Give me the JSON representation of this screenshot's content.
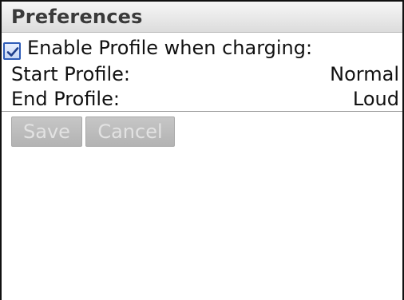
{
  "window": {
    "title": "Preferences"
  },
  "preferences": {
    "enable_profile_label": "Enable Profile when charging:",
    "enable_profile_checked": true,
    "start_profile_label": "Start Profile:",
    "start_profile_value": "Normal",
    "end_profile_label": "End Profile:",
    "end_profile_value": "Loud"
  },
  "buttons": {
    "save_label": "Save",
    "cancel_label": "Cancel",
    "enabled": false
  },
  "colors": {
    "checkbox_accent": "#2f5db8",
    "disabled_button_bg": "#bdbdbd",
    "disabled_button_text": "#e2e2e2"
  },
  "icons": {
    "checkbox": "checkmark-icon"
  }
}
